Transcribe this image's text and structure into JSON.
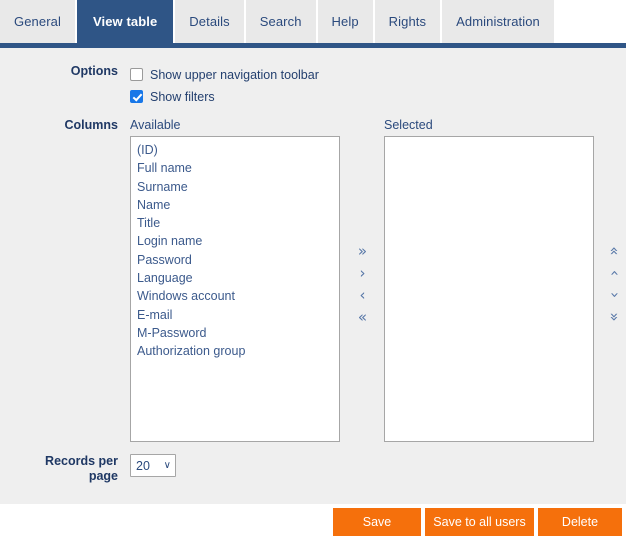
{
  "tabs": [
    {
      "label": "General",
      "active": false
    },
    {
      "label": "View table",
      "active": true
    },
    {
      "label": "Details",
      "active": false
    },
    {
      "label": "Search",
      "active": false
    },
    {
      "label": "Help",
      "active": false
    },
    {
      "label": "Rights",
      "active": false
    },
    {
      "label": "Administration",
      "active": false
    }
  ],
  "options": {
    "label": "Options",
    "items": [
      {
        "label": "Show upper navigation toolbar",
        "checked": false
      },
      {
        "label": "Show filters",
        "checked": true
      }
    ]
  },
  "columns": {
    "label": "Columns",
    "available_label": "Available",
    "selected_label": "Selected",
    "available": [
      "(ID)",
      "Full name",
      "Surname",
      "Name",
      "Title",
      "Login name",
      "Password",
      "Language",
      "Windows account",
      "E-mail",
      "M-Password",
      "Authorization group"
    ],
    "selected": [],
    "transfer_arrows": [
      {
        "glyph": "»",
        "name": "move-all-right"
      },
      {
        "glyph": "›",
        "name": "move-right"
      },
      {
        "glyph": "‹",
        "name": "move-left"
      },
      {
        "glyph": "«",
        "name": "move-all-left"
      }
    ],
    "order_arrows": [
      {
        "glyph": "«",
        "name": "move-to-top"
      },
      {
        "glyph": "‹",
        "name": "move-up"
      },
      {
        "glyph": "›",
        "name": "move-down"
      },
      {
        "glyph": "»",
        "name": "move-to-bottom"
      }
    ]
  },
  "records": {
    "label_line1": "Records per",
    "label_line2": "page",
    "value": "20",
    "chevron": "∨"
  },
  "footer": {
    "save": "Save",
    "save_all": "Save to all users",
    "delete": "Delete"
  },
  "colors": {
    "accent_navy": "#2f5586",
    "button_orange": "#f5700c",
    "checkbox_blue": "#1877e8",
    "panel_bg": "#efefef"
  }
}
